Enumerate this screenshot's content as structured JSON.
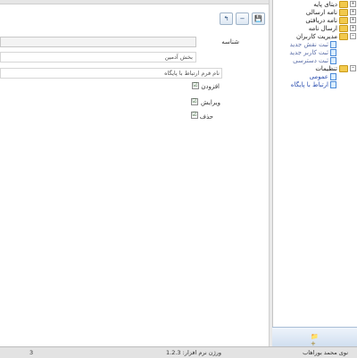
{
  "toolbar": {
    "save_icon": "💾",
    "minus_icon": "−",
    "back_icon": "↰"
  },
  "form": {
    "field_shenase": {
      "label": "شناسه",
      "value": ""
    },
    "field_bakhsh": {
      "label": "",
      "value": "بخش آدمین"
    },
    "field_nam_form": {
      "label": "",
      "value": "نام فرم ارتباط با پایگاه"
    },
    "checkboxes": [
      {
        "label": "افزودن",
        "checked": "☑"
      },
      {
        "label": "ویرایش",
        "checked": "☑"
      },
      {
        "label": "حذف",
        "checked": "☑"
      }
    ]
  },
  "tree": {
    "items": [
      {
        "label": "دیتای پایه",
        "type": "folder",
        "expander": "+"
      },
      {
        "label": "نامه ارسالی",
        "type": "folder",
        "expander": "+"
      },
      {
        "label": "نامه دریافتی",
        "type": "folder",
        "expander": "+"
      },
      {
        "label": "ارسال نامه",
        "type": "folder",
        "expander": "+"
      },
      {
        "label": "مدیریت کاربران",
        "type": "folder",
        "expander": "−"
      },
      {
        "label": "ثبت نقش جدید",
        "type": "doc"
      },
      {
        "label": "ثبت کاربر جدید",
        "type": "doc"
      },
      {
        "label": "ثبت دسترسی",
        "type": "doc"
      },
      {
        "label": "تنظیمات",
        "type": "folder",
        "expander": "−"
      },
      {
        "label": "عمومی",
        "type": "doc"
      },
      {
        "label": "ارتباط با پایگاه",
        "type": "doc"
      }
    ],
    "add_icon": "📁+"
  },
  "status": {
    "user": "نوی محمد بوراهاب",
    "version": "ورژن نرم افزار: 1.2.3",
    "number": "3"
  }
}
